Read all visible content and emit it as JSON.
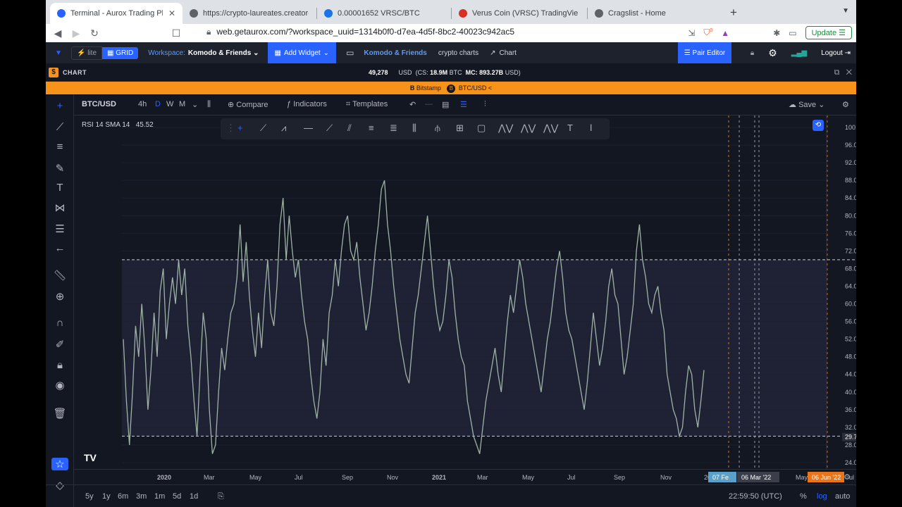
{
  "browser": {
    "tabs": [
      {
        "title": "Terminal - Aurox Trading Platfo",
        "active": true,
        "color": "#2962ff"
      },
      {
        "title": "https://crypto-laureates.creator-sp",
        "active": false,
        "color": "#5f6368"
      },
      {
        "title": "0.00001652 VRSC/BTC",
        "active": false,
        "color": "#1a73e8"
      },
      {
        "title": "Verus Coin (VRSC) TradingView Ch",
        "active": false,
        "color": "#d93025"
      },
      {
        "title": "Cragslist - Home",
        "active": false,
        "color": "#5f6368"
      }
    ],
    "url": "web.getaurox.com/?workspace_uuid=1314b0f0-d7ea-4d5f-8bc2-40023c942ac5",
    "update_label": "Update",
    "shield_badge": "0"
  },
  "app": {
    "lite_label": "lite",
    "grid_label": "GRID",
    "workspace_label": "Workspace:",
    "workspace_name": "Komodo & Friends",
    "add_widget_label": "Add Widget",
    "ws_link": "Komodo & Friends",
    "crypto_charts": "crypto charts",
    "chart_label": "Chart",
    "pair_editor": "Pair Editor",
    "logout": "Logout"
  },
  "panel": {
    "dollar": "$",
    "title": "CHART",
    "price": "49,278",
    "usd1": "USD",
    "cs_prefix": "(CS:",
    "cs_value": "18.9M",
    "btc": "BTC",
    "mc_prefix": "MC:",
    "mc_value": "893.27B",
    "usd2": "USD)"
  },
  "exchange": {
    "coin": "B",
    "exchange": "Bitstamp",
    "coin2": "B",
    "pair": "BTC/USD"
  },
  "toolbar": {
    "symbol": "BTC/USD",
    "intervals": [
      "4h",
      "D",
      "W",
      "M"
    ],
    "compare": "Compare",
    "indicators": "Indicators",
    "templates": "Templates",
    "save": "Save"
  },
  "bottom": {
    "ranges": [
      "5y",
      "1y",
      "6m",
      "3m",
      "1m",
      "5d",
      "1d"
    ],
    "clock": "22:59:50 (UTC)",
    "percent": "%",
    "log": "log",
    "auto": "auto"
  },
  "colors": {
    "background": "#131722",
    "accent": "#2962ff",
    "orange": "#f7931a",
    "rsi_line": "#9fb3a5",
    "date_marker_blue": "#5aa0c8",
    "date_marker_orange": "#e8751a"
  },
  "chart_data": {
    "type": "line",
    "legend": "RSI 14 SMA 14",
    "last_value_label": "45.52",
    "current_value": "29.79",
    "ylim": [
      24,
      100
    ],
    "y_ticks": [
      "100.00",
      "96.00",
      "92.00",
      "88.00",
      "84.00",
      "80.00",
      "76.00",
      "72.00",
      "68.00",
      "64.00",
      "60.00",
      "56.00",
      "52.00",
      "48.00",
      "44.00",
      "40.00",
      "36.00",
      "32.00",
      "28.00",
      "24.00"
    ],
    "x_ticks": [
      "2020",
      "Mar",
      "May",
      "Jul",
      "Sep",
      "Nov",
      "2021",
      "Mar",
      "May",
      "Jul",
      "Sep",
      "Nov",
      "20",
      "24",
      "May",
      "ul"
    ],
    "date_markers": [
      "07 Fe",
      "06 Mar '22",
      "06 Jun '22"
    ],
    "hlines": [
      70,
      30
    ],
    "series": [
      {
        "values": [
          52,
          38,
          28,
          40,
          55,
          48,
          60,
          50,
          36,
          45,
          58,
          48,
          63,
          68,
          52,
          60,
          66,
          60,
          70,
          62,
          68,
          55,
          48,
          38,
          30,
          45,
          58,
          52,
          36,
          26,
          28,
          40,
          50,
          45,
          52,
          58,
          60,
          66,
          78,
          65,
          74,
          62,
          54,
          48,
          58,
          50,
          62,
          70,
          58,
          55,
          64,
          78,
          84,
          70,
          80,
          72,
          66,
          70,
          62,
          56,
          52,
          44,
          38,
          34,
          40,
          52,
          46,
          58,
          62,
          70,
          64,
          72,
          78,
          80,
          72,
          70,
          74,
          66,
          60,
          54,
          58,
          64,
          72,
          78,
          86,
          88,
          78,
          72,
          64,
          58,
          52,
          48,
          44,
          42,
          50,
          58,
          62,
          68,
          74,
          80,
          72,
          64,
          58,
          54,
          56,
          62,
          70,
          66,
          58,
          52,
          48,
          46,
          38,
          34,
          30,
          28,
          26,
          32,
          38,
          42,
          46,
          50,
          44,
          40,
          48,
          56,
          62,
          58,
          64,
          70,
          66,
          60,
          56,
          52,
          48,
          44,
          40,
          46,
          52,
          56,
          62,
          68,
          72,
          66,
          58,
          54,
          52,
          48,
          44,
          40,
          36,
          42,
          50,
          58,
          52,
          46,
          50,
          56,
          64,
          68,
          62,
          60,
          52,
          44,
          48,
          54,
          60,
          72,
          78,
          70,
          66,
          60,
          58,
          62,
          64,
          58,
          54,
          44,
          40,
          36,
          34,
          30,
          32,
          40,
          46,
          44,
          36,
          32,
          38,
          45
        ]
      }
    ]
  }
}
